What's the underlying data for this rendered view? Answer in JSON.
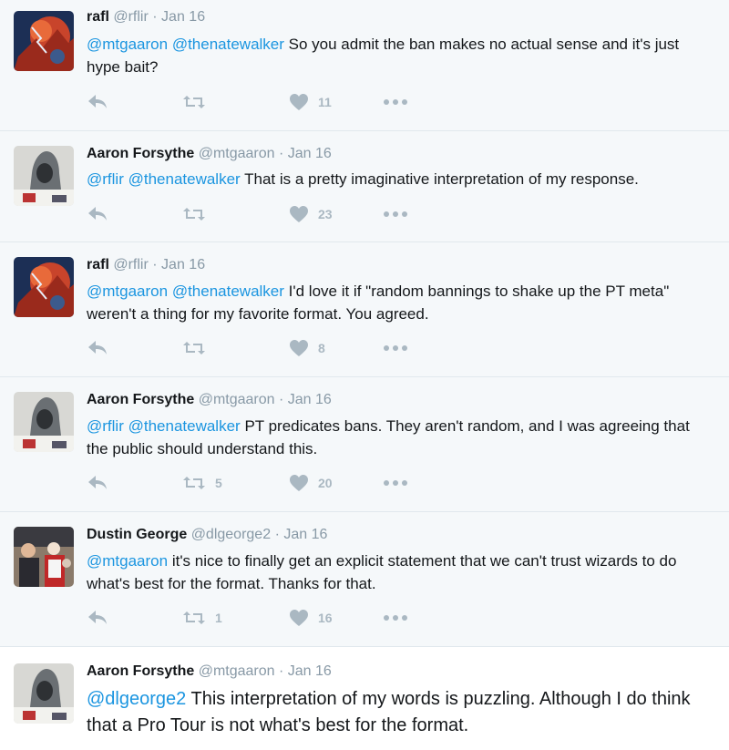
{
  "tweets": [
    {
      "name": "rafl",
      "handle": "@rflir",
      "date": "Jan 16",
      "mentions": [
        "@mtgaaron",
        "@thenatewalker"
      ],
      "text": "So you admit the ban makes no actual sense and it's just hype bait?",
      "retweets": "",
      "likes": "11",
      "avatar_icon": "red-storm-avatar"
    },
    {
      "name": "Aaron Forsythe",
      "handle": "@mtgaaron",
      "date": "Jan 16",
      "mentions": [
        "@rflir",
        "@thenatewalker"
      ],
      "text": "That is a pretty imaginative interpretation of my response.",
      "retweets": "",
      "likes": "23",
      "avatar_icon": "grey-hood-avatar"
    },
    {
      "name": "rafl",
      "handle": "@rflir",
      "date": "Jan 16",
      "mentions": [
        "@mtgaaron",
        "@thenatewalker"
      ],
      "text": "I'd love it if \"random bannings to shake up the PT meta\" weren't a thing for my favorite format. You agreed.",
      "retweets": "",
      "likes": "8",
      "avatar_icon": "red-storm-avatar"
    },
    {
      "name": "Aaron Forsythe",
      "handle": "@mtgaaron",
      "date": "Jan 16",
      "mentions": [
        "@rflir",
        "@thenatewalker"
      ],
      "text": "PT predicates bans. They aren't random, and I was agreeing that the public should understand this.",
      "retweets": "5",
      "likes": "20",
      "avatar_icon": "grey-hood-avatar"
    },
    {
      "name": "Dustin George",
      "handle": "@dlgeorge2",
      "date": "Jan 16",
      "mentions": [
        "@mtgaaron"
      ],
      "text": "it's nice to finally get an explicit statement that we can't trust wizards to do what's best for the format. Thanks for that.",
      "retweets": "1",
      "likes": "16",
      "avatar_icon": "crowd-photo-avatar"
    },
    {
      "name": "Aaron Forsythe",
      "handle": "@mtgaaron",
      "date": "Jan 16",
      "mentions": [
        "@dlgeorge2"
      ],
      "text": "This interpretation of my words is puzzling. Although I do think that a Pro Tour is not what's best for the format.",
      "avatar_icon": "grey-hood-avatar"
    }
  ],
  "separator": "·",
  "icons": {
    "reply": "reply-icon",
    "retweet": "retweet-icon",
    "like": "heart-icon",
    "more": "more-dots-icon"
  },
  "colors": {
    "link": "#1b95e0",
    "muted": "#8899a6",
    "action": "#aab8c2",
    "name": "#14171a"
  }
}
